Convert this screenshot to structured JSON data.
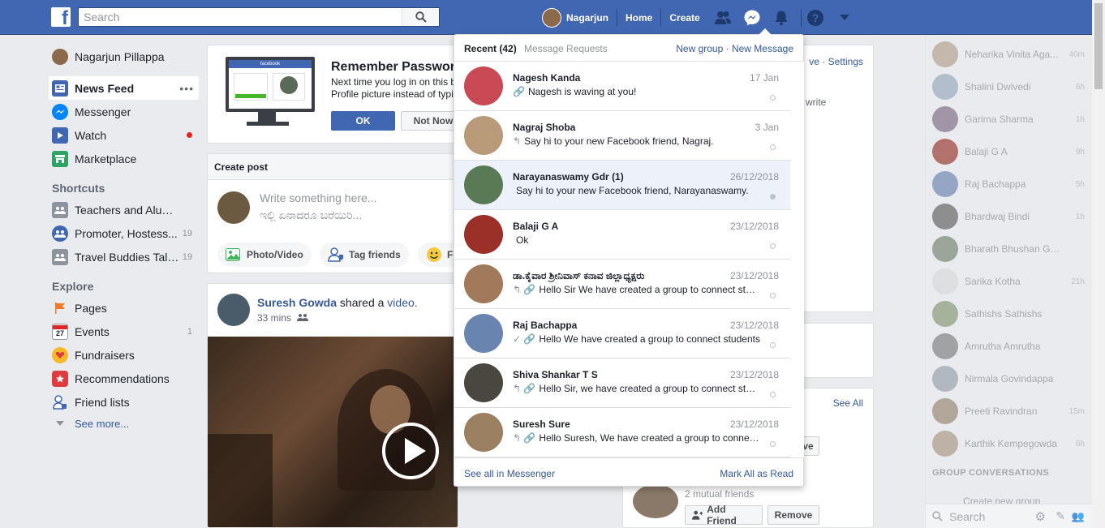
{
  "topbar": {
    "logo": "f",
    "search_placeholder": "Search",
    "user_name": "Nagarjun",
    "home": "Home",
    "create": "Create"
  },
  "leftnav": {
    "profile": "Nagarjun Pillappa",
    "main": [
      {
        "label": "News Feed",
        "icon": "news-feed-icon",
        "more": "•••"
      },
      {
        "label": "Messenger",
        "icon": "messenger-icon"
      },
      {
        "label": "Watch",
        "icon": "watch-icon"
      },
      {
        "label": "Marketplace",
        "icon": "marketplace-icon"
      }
    ],
    "shortcuts_head": "Shortcuts",
    "shortcuts": [
      {
        "label": "Teachers and Alum...",
        "count": ""
      },
      {
        "label": "Promoter, Hostess...",
        "count": "19"
      },
      {
        "label": "Travel Buddies Talk...",
        "count": "19"
      }
    ],
    "explore_head": "Explore",
    "explore": [
      {
        "label": "Pages",
        "count": ""
      },
      {
        "label": "Events",
        "count": "1"
      },
      {
        "label": "Fundraisers",
        "count": ""
      },
      {
        "label": "Recommendations",
        "count": ""
      },
      {
        "label": "Friend lists",
        "count": ""
      }
    ],
    "see_more": "See more..."
  },
  "remember": {
    "title": "Remember Password",
    "text": "Next time you log in on this browser, just click your Profile picture instead of typing a password.",
    "ok": "OK",
    "not_now": "Not Now",
    "screen_label": "facebook"
  },
  "create_post": {
    "head": "Create post",
    "placeholder_1": "Write something here...",
    "placeholder_2": "ಇಲ್ಲಿ ಏನಾದರೂ ಬರೆಯಿರಿ...",
    "photo_video": "Photo/Video",
    "tag_friends": "Tag friends",
    "feeling": "Fe"
  },
  "post": {
    "author": "Suresh Gowda",
    "action": "shared a",
    "object": "video.",
    "time": "33 mins"
  },
  "right": {
    "links": "ve · Settings",
    "write": "write",
    "see_all": "See All",
    "mutual": "2 mutual friends",
    "add_friend": "Add Friend",
    "remove": "Remove",
    "btn_partial": "ve"
  },
  "messenger": {
    "recent": "Recent (42)",
    "requests": "Message Requests",
    "new_group": "New group",
    "new_message": "New Message",
    "see_all": "See all in Messenger",
    "mark_all": "Mark All as Read",
    "messages": [
      {
        "name": "Nagesh Kanda",
        "date": "17 Jan",
        "prefix": "🔗",
        "snippet": "Nagesh is waving at you!",
        "unread": false,
        "color": "#c94a55"
      },
      {
        "name": "Nagraj Shoba",
        "date": "3 Jan",
        "prefix": "↰",
        "snippet": "Say hi to your new Facebook friend, Nagraj.",
        "unread": false,
        "color": "#b89a78"
      },
      {
        "name": "Narayanaswamy Gdr (1)",
        "date": "26/12/2018",
        "prefix": "",
        "snippet": "Say hi to your new Facebook friend, Narayanaswamy.",
        "unread": true,
        "color": "#5a7a56"
      },
      {
        "name": "Balaji G A",
        "date": "23/12/2018",
        "prefix": "",
        "snippet": "Ok",
        "unread": false,
        "color": "#9a3028"
      },
      {
        "name": "ಡಾ.ಕೈವಾರ ಶ್ರೀನಿವಾಸ್ ಕನಾವ ಜಿಲ್ಲಾಧ್ಯಕ್ಷರು",
        "date": "23/12/2018",
        "prefix": "↰ 🔗",
        "snippet": "Hello Sir We have created a group to connect students",
        "unread": false,
        "color": "#a07a5a"
      },
      {
        "name": "Raj Bachappa",
        "date": "23/12/2018",
        "prefix": "✓ 🔗",
        "snippet": "Hello We have created a group to connect students",
        "unread": false,
        "color": "#6a84b0"
      },
      {
        "name": "Shiva Shankar T S",
        "date": "23/12/2018",
        "prefix": "↰ 🔗",
        "snippet": "Hello Sir, we have created a group to connect students",
        "unread": false,
        "color": "#4a4640"
      },
      {
        "name": "Suresh Sure",
        "date": "23/12/2018",
        "prefix": "↰ 🔗",
        "snippet": "Hello Suresh, We have created a group to connect students",
        "unread": false,
        "color": "#9a8060"
      }
    ]
  },
  "chat": {
    "contacts": [
      {
        "name": "Neharika Vinita Aga...",
        "time": "40m",
        "color": "#b8a898"
      },
      {
        "name": "Shalini Dwivedi",
        "time": "6h",
        "color": "#a0b0c0"
      },
      {
        "name": "Garima Sharma",
        "time": "1h",
        "color": "#8a7a90"
      },
      {
        "name": "Balaji G A",
        "time": "9h",
        "color": "#a04a40"
      },
      {
        "name": "Raj Bachappa",
        "time": "5h",
        "color": "#7a90b8"
      },
      {
        "name": "Bhardwaj Bindi",
        "time": "1h",
        "color": "#707070"
      },
      {
        "name": "Bharath Bhushan Go...",
        "time": "",
        "color": "#80907a"
      },
      {
        "name": "Sarika Kotha",
        "time": "21h",
        "color": "#d8dadc"
      },
      {
        "name": "Sathishs Sathishs",
        "time": "",
        "color": "#90a080"
      },
      {
        "name": "Amrutha Amrutha",
        "time": "",
        "color": "#8a8a8a"
      },
      {
        "name": "Nirmala Govindappa",
        "time": "",
        "color": "#a0a8b0"
      },
      {
        "name": "Preeti Ravindran",
        "time": "15m",
        "color": "#a09080"
      },
      {
        "name": "Karthik Kempegowda",
        "time": "6h",
        "color": "#b0a090"
      }
    ],
    "group_head": "GROUP CONVERSATIONS",
    "create_group": "Create new group",
    "search": "Search"
  }
}
